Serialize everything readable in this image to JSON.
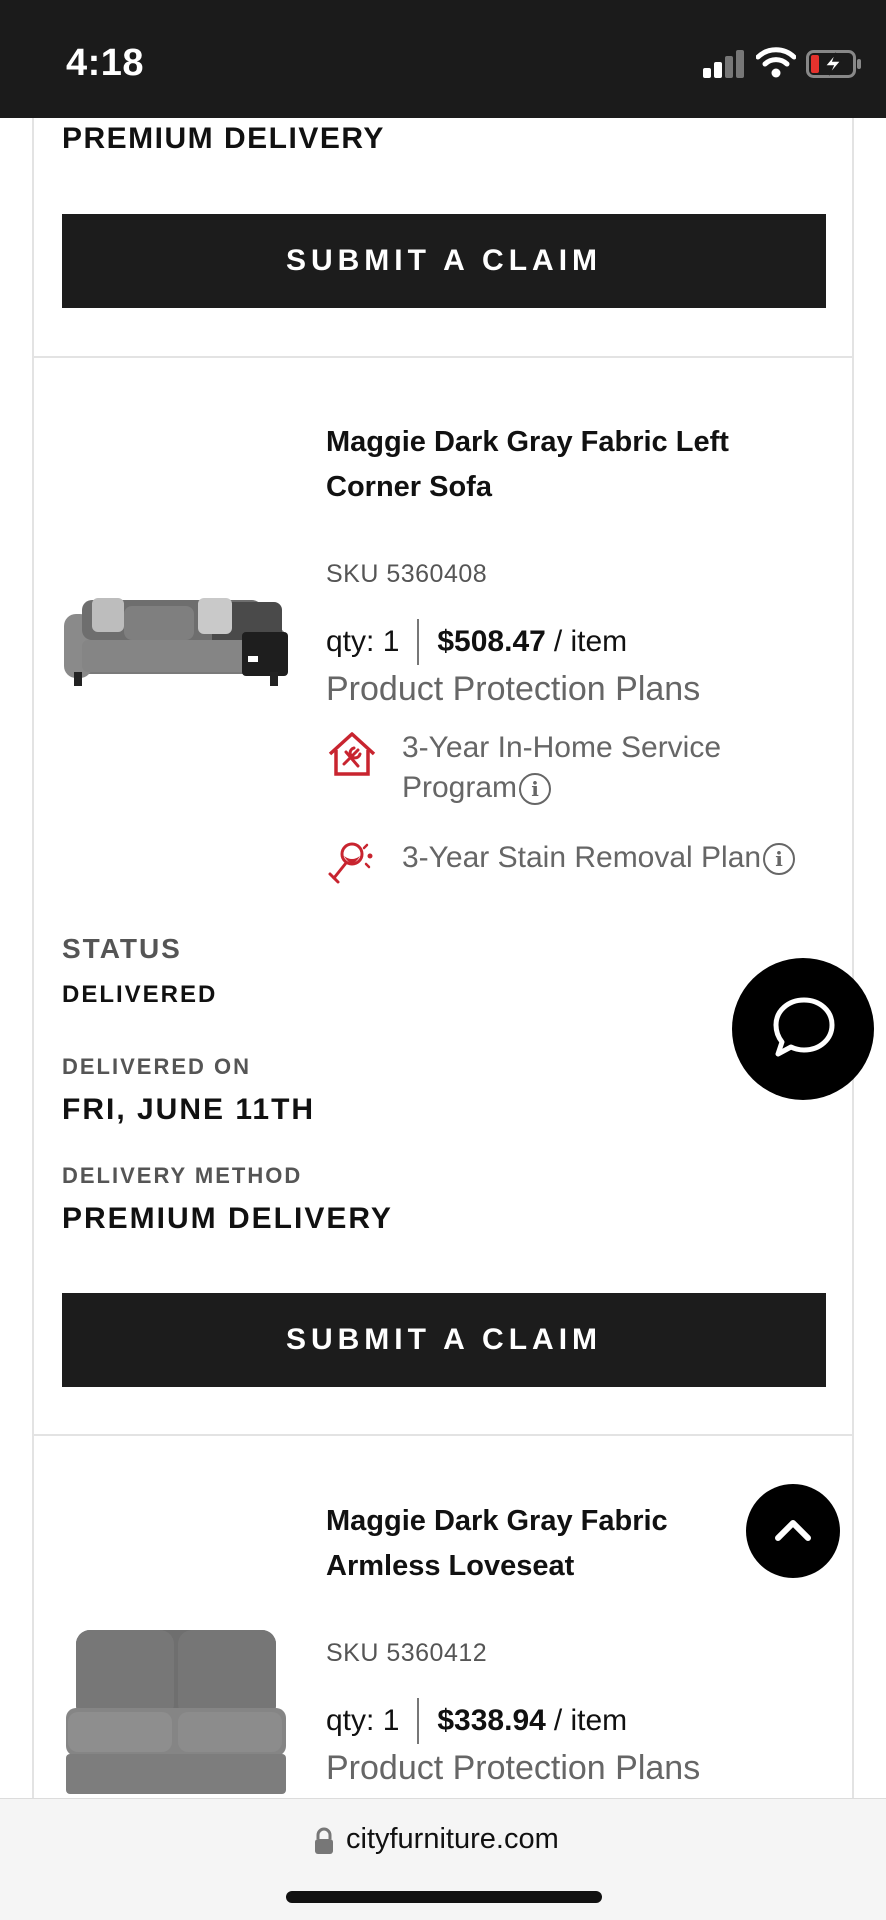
{
  "status_bar": {
    "time": "4:18"
  },
  "top_section": {
    "delivery_method_value": "PREMIUM DELIVERY",
    "claim_button": "SUBMIT A CLAIM"
  },
  "item1": {
    "title": "Maggie Dark Gray Fabric Left Corner Sofa",
    "sku": "SKU 5360408",
    "qty": "qty: 1",
    "price": "$508.47",
    "per_item": "/ item",
    "protection_header": "Product Protection Plans",
    "plans": [
      {
        "label": "3-Year In-Home Service Program",
        "icon": "home-service-icon"
      },
      {
        "label": "3-Year Stain Removal Plan",
        "icon": "stain-removal-icon"
      }
    ],
    "status_label": "STATUS",
    "status_value": "DELIVERED",
    "delivered_on_label": "DELIVERED ON",
    "delivered_on_value": "FRI, JUNE 11TH",
    "delivery_method_label": "DELIVERY METHOD",
    "delivery_method_value": "PREMIUM DELIVERY",
    "claim_button": "SUBMIT A CLAIM"
  },
  "item2": {
    "title": "Maggie Dark Gray Fabric Armless Loveseat",
    "sku": "SKU 5360412",
    "qty": "qty: 1",
    "price": "$338.94",
    "per_item": "/ item",
    "protection_header": "Product Protection Plans"
  },
  "browser": {
    "url": "cityfurniture.com"
  },
  "colors": {
    "button_bg": "#1c1c1c",
    "plan_icon": "#c8242f",
    "divider": "#e3e3e3"
  }
}
